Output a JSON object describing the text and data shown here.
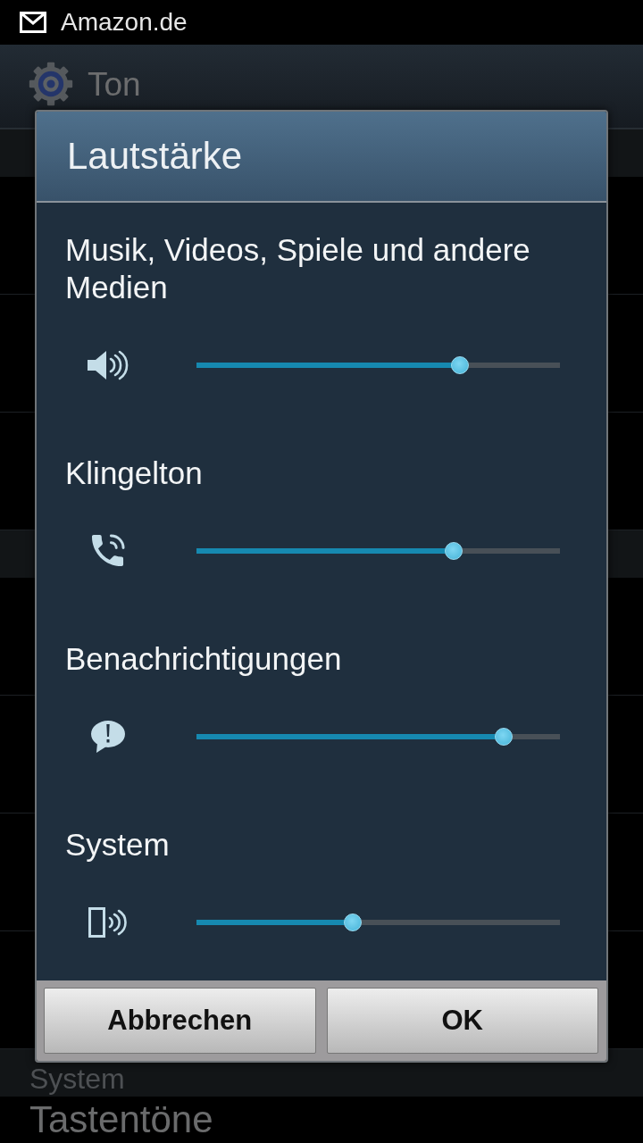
{
  "status_bar": {
    "notification": "Amazon.de"
  },
  "action_bar": {
    "title": "Ton"
  },
  "settings_list": [
    {
      "kind": "header",
      "label": "System"
    },
    {
      "kind": "item",
      "label": "Tastentöne"
    }
  ],
  "dialog": {
    "title": "Lautstärke",
    "sliders": [
      {
        "kind": "media",
        "label": "Musik, Videos, Spiele und andere Medien",
        "level": 0.725
      },
      {
        "kind": "ringtone",
        "label": "Klingelton",
        "level": 0.708
      },
      {
        "kind": "notification",
        "label": "Benachrichtigungen",
        "level": 0.845
      },
      {
        "kind": "system",
        "label": "System",
        "level": 0.43
      }
    ],
    "buttons": [
      "Abbrechen",
      "OK"
    ]
  }
}
